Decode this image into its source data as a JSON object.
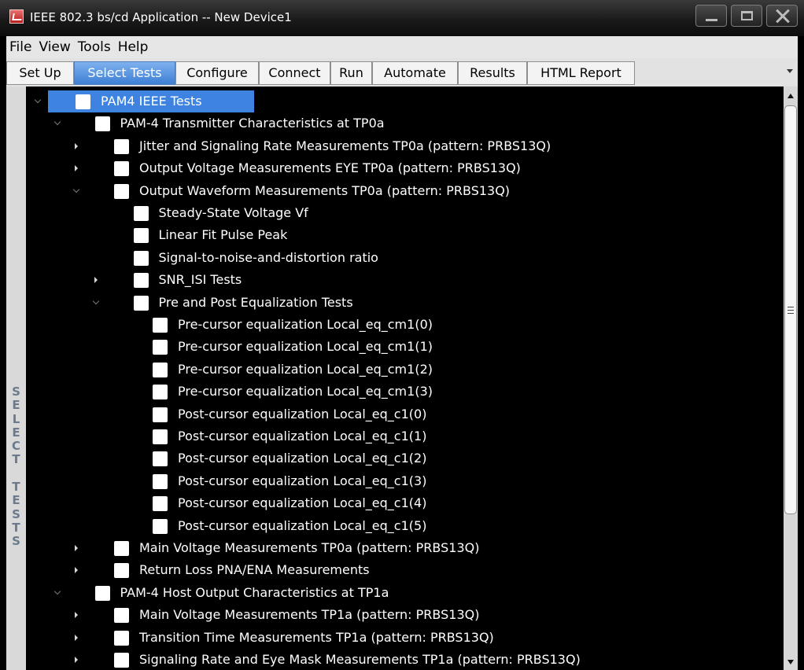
{
  "window": {
    "title": "IEEE 802.3 bs/cd Application -- New Device1"
  },
  "menu": [
    "File",
    "View",
    "Tools",
    "Help"
  ],
  "tabs": [
    {
      "label": "Set Up"
    },
    {
      "label": "Select Tests",
      "active": true
    },
    {
      "label": "Configure"
    },
    {
      "label": "Connect"
    },
    {
      "label": "Run"
    },
    {
      "label": "Automate"
    },
    {
      "label": "Results"
    },
    {
      "label": "HTML Report"
    }
  ],
  "side_label": "SELECT TESTS",
  "tree": [
    {
      "label": "PAM4 IEEE Tests",
      "level": 0,
      "expander": "expanded",
      "checked": false,
      "selected": true
    },
    {
      "label": "PAM-4 Transmitter Characteristics at TP0a",
      "level": 1,
      "expander": "expanded",
      "checked": false
    },
    {
      "label": "Jitter and Signaling Rate Measurements TP0a (pattern: PRBS13Q)",
      "level": 2,
      "expander": "collapsed",
      "checked": false
    },
    {
      "label": "Output Voltage Measurements EYE TP0a (pattern: PRBS13Q)",
      "level": 2,
      "expander": "collapsed",
      "checked": false
    },
    {
      "label": "Output Waveform Measurements TP0a (pattern: PRBS13Q)",
      "level": 2,
      "expander": "expanded",
      "checked": false
    },
    {
      "label": "Steady-State Voltage Vf",
      "level": 3,
      "expander": "none",
      "checked": false
    },
    {
      "label": "Linear Fit Pulse Peak",
      "level": 3,
      "expander": "none",
      "checked": false
    },
    {
      "label": "Signal-to-noise-and-distortion ratio",
      "level": 3,
      "expander": "none",
      "checked": false
    },
    {
      "label": "SNR_ISI Tests",
      "level": 3,
      "expander": "collapsed",
      "checked": false
    },
    {
      "label": "Pre and Post Equalization Tests",
      "level": 3,
      "expander": "expanded",
      "checked": false
    },
    {
      "label": "Pre-cursor equalization Local_eq_cm1(0)",
      "level": 4,
      "expander": "none",
      "checked": false
    },
    {
      "label": "Pre-cursor equalization Local_eq_cm1(1)",
      "level": 4,
      "expander": "none",
      "checked": false
    },
    {
      "label": "Pre-cursor equalization Local_eq_cm1(2)",
      "level": 4,
      "expander": "none",
      "checked": false
    },
    {
      "label": "Pre-cursor equalization Local_eq_cm1(3)",
      "level": 4,
      "expander": "none",
      "checked": false
    },
    {
      "label": "Post-cursor equalization Local_eq_c1(0)",
      "level": 4,
      "expander": "none",
      "checked": false
    },
    {
      "label": "Post-cursor equalization Local_eq_c1(1)",
      "level": 4,
      "expander": "none",
      "checked": false
    },
    {
      "label": "Post-cursor equalization Local_eq_c1(2)",
      "level": 4,
      "expander": "none",
      "checked": false
    },
    {
      "label": "Post-cursor equalization Local_eq_c1(3)",
      "level": 4,
      "expander": "none",
      "checked": false
    },
    {
      "label": "Post-cursor equalization Local_eq_c1(4)",
      "level": 4,
      "expander": "none",
      "checked": false
    },
    {
      "label": "Post-cursor equalization Local_eq_c1(5)",
      "level": 4,
      "expander": "none",
      "checked": false
    },
    {
      "label": "Main Voltage Measurements TP0a (pattern: PRBS13Q)",
      "level": 2,
      "expander": "collapsed",
      "checked": false
    },
    {
      "label": "Return Loss PNA/ENA Measurements",
      "level": 2,
      "expander": "collapsed",
      "checked": false
    },
    {
      "label": "PAM-4 Host Output Characteristics at TP1a",
      "level": 1,
      "expander": "expanded",
      "checked": false
    },
    {
      "label": "Main Voltage Measurements TP1a (pattern: PRBS13Q)",
      "level": 2,
      "expander": "collapsed",
      "checked": false
    },
    {
      "label": "Transition Time Measurements TP1a (pattern: PRBS13Q)",
      "level": 2,
      "expander": "collapsed",
      "checked": false
    },
    {
      "label": "Signaling Rate and Eye Mask Measurements TP1a (pattern: PRBS13Q)",
      "level": 2,
      "expander": "collapsed",
      "checked": false
    }
  ]
}
